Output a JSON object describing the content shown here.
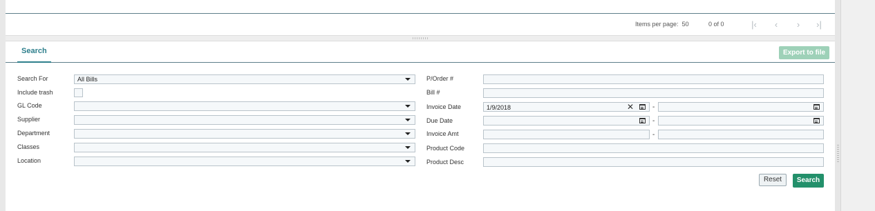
{
  "pager": {
    "items_per_page_label": "Items per page:",
    "items_per_page_value": "50",
    "count": "0 of 0",
    "first_glyph": "|‹",
    "prev_glyph": "‹",
    "next_glyph": "›",
    "last_glyph": "›|"
  },
  "tabs": {
    "search_label": "Search"
  },
  "toolbar": {
    "export_label": "Export to file"
  },
  "form": {
    "search_for": {
      "label": "Search For",
      "value": "All Bills"
    },
    "include_trash": {
      "label": "Include trash",
      "checked": false
    },
    "gl_code": {
      "label": "GL Code",
      "value": ""
    },
    "supplier": {
      "label": "Supplier",
      "value": ""
    },
    "department": {
      "label": "Department",
      "value": ""
    },
    "classes": {
      "label": "Classes",
      "value": ""
    },
    "location": {
      "label": "Location",
      "value": ""
    },
    "po_number": {
      "label": "P/Order #",
      "value": ""
    },
    "bill_number": {
      "label": "Bill #",
      "value": ""
    },
    "invoice_date": {
      "label": "Invoice Date",
      "from": "1/9/2018",
      "to": ""
    },
    "due_date": {
      "label": "Due Date",
      "from": "",
      "to": ""
    },
    "invoice_amt": {
      "label": "Invoice Amt",
      "from": "",
      "to": ""
    },
    "product_code": {
      "label": "Product Code",
      "value": ""
    },
    "product_desc": {
      "label": "Product Desc",
      "value": ""
    },
    "range_separator": "-"
  },
  "actions": {
    "reset_label": "Reset",
    "search_label": "Search"
  },
  "colors": {
    "accent": "#2e7f8c",
    "primary_button": "#23906b",
    "export_button_disabled": "#9ed1b8"
  },
  "icons": {
    "clear": "clear-icon",
    "calendar": "calendar-icon",
    "dropdown": "chevron-down-icon"
  }
}
